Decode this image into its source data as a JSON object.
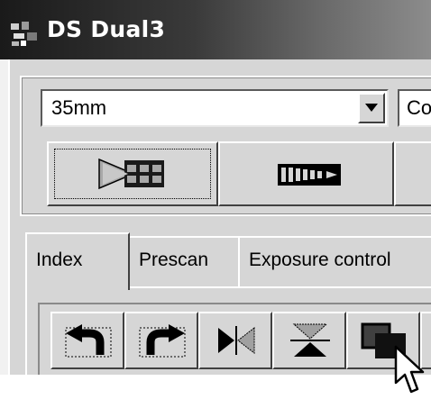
{
  "window": {
    "title": "DS Dual3"
  },
  "film_type": {
    "selected": "35mm"
  },
  "second_combo": {
    "selected": "Co"
  },
  "tabs": [
    {
      "label": "Index"
    },
    {
      "label": "Prescan"
    },
    {
      "label": "Exposure control"
    }
  ],
  "toolbar_top": [
    {
      "icon": "scan-frames-icon"
    },
    {
      "icon": "film-strip-eject-icon"
    }
  ],
  "toolbar_bottom": [
    {
      "icon": "rotate-left-icon"
    },
    {
      "icon": "rotate-right-icon"
    },
    {
      "icon": "flip-horizontal-icon"
    },
    {
      "icon": "flip-vertical-icon"
    },
    {
      "icon": "overlap-icon"
    }
  ]
}
